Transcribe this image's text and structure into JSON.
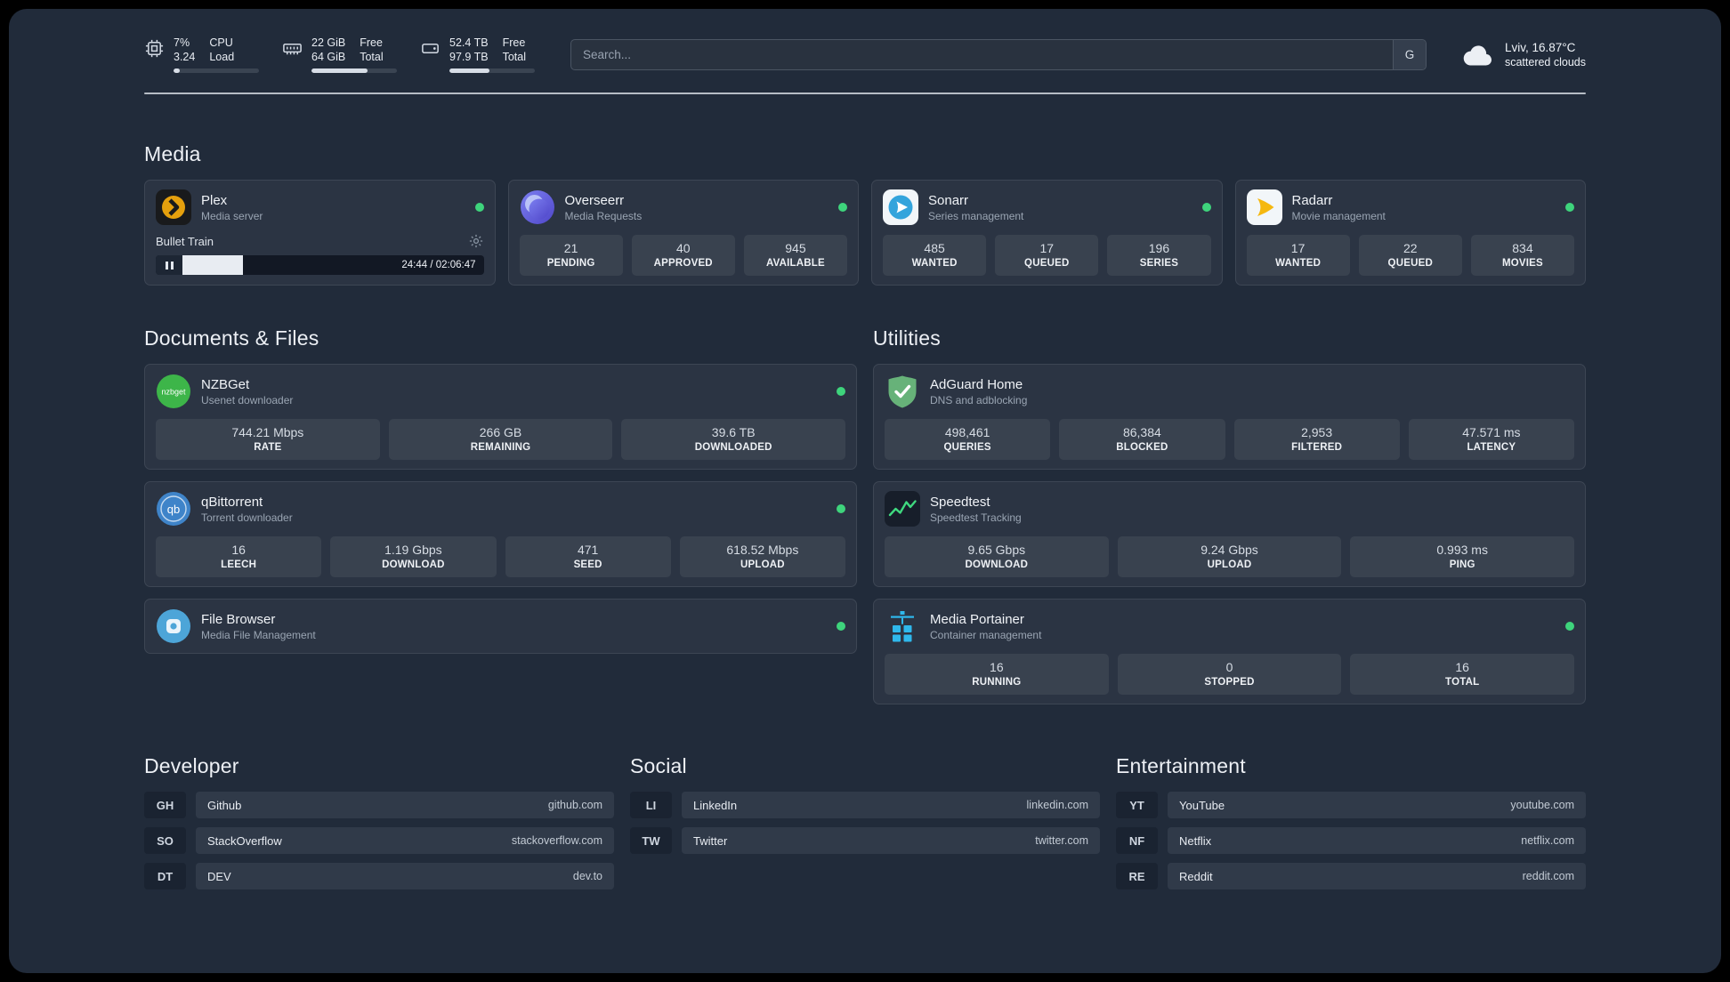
{
  "topbar": {
    "cpu": {
      "line1": "7%",
      "line2": "3.24",
      "label1": "CPU",
      "label2": "Load",
      "progress": 7
    },
    "ram": {
      "line1": "22 GiB",
      "line2": "64 GiB",
      "label1": "Free",
      "label2": "Total",
      "progress": 66
    },
    "disk": {
      "line1": "52.4 TB",
      "line2": "97.9 TB",
      "label1": "Free",
      "label2": "Total",
      "progress": 47
    },
    "search": {
      "placeholder": "Search...",
      "button_label": "G"
    },
    "weather": {
      "location": "Lviv, 16.87°C",
      "condition": "scattered clouds"
    }
  },
  "sections": {
    "media": {
      "title": "Media"
    },
    "documents": {
      "title": "Documents & Files"
    },
    "utilities": {
      "title": "Utilities"
    },
    "developer": {
      "title": "Developer"
    },
    "social": {
      "title": "Social"
    },
    "entertainment": {
      "title": "Entertainment"
    }
  },
  "apps": {
    "plex": {
      "name": "Plex",
      "subtitle": "Media server",
      "player": {
        "track": "Bullet Train",
        "time": "24:44 / 02:06:47",
        "progress": 20
      }
    },
    "overseerr": {
      "name": "Overseerr",
      "subtitle": "Media Requests",
      "stats": [
        {
          "value": "21",
          "label": "PENDING"
        },
        {
          "value": "40",
          "label": "APPROVED"
        },
        {
          "value": "945",
          "label": "AVAILABLE"
        }
      ]
    },
    "sonarr": {
      "name": "Sonarr",
      "subtitle": "Series management",
      "stats": [
        {
          "value": "485",
          "label": "WANTED"
        },
        {
          "value": "17",
          "label": "QUEUED"
        },
        {
          "value": "196",
          "label": "SERIES"
        }
      ]
    },
    "radarr": {
      "name": "Radarr",
      "subtitle": "Movie management",
      "stats": [
        {
          "value": "17",
          "label": "WANTED"
        },
        {
          "value": "22",
          "label": "QUEUED"
        },
        {
          "value": "834",
          "label": "MOVIES"
        }
      ]
    },
    "nzbget": {
      "name": "NZBGet",
      "subtitle": "Usenet downloader",
      "stats": [
        {
          "value": "744.21 Mbps",
          "label": "RATE"
        },
        {
          "value": "266 GB",
          "label": "REMAINING"
        },
        {
          "value": "39.6 TB",
          "label": "DOWNLOADED"
        }
      ]
    },
    "qbittorrent": {
      "name": "qBittorrent",
      "subtitle": "Torrent downloader",
      "stats": [
        {
          "value": "16",
          "label": "LEECH"
        },
        {
          "value": "1.19 Gbps",
          "label": "DOWNLOAD"
        },
        {
          "value": "471",
          "label": "SEED"
        },
        {
          "value": "618.52 Mbps",
          "label": "UPLOAD"
        }
      ]
    },
    "filebrowser": {
      "name": "File Browser",
      "subtitle": "Media File Management"
    },
    "adguard": {
      "name": "AdGuard Home",
      "subtitle": "DNS and adblocking",
      "stats": [
        {
          "value": "498,461",
          "label": "QUERIES"
        },
        {
          "value": "86,384",
          "label": "BLOCKED"
        },
        {
          "value": "2,953",
          "label": "FILTERED"
        },
        {
          "value": "47.571 ms",
          "label": "LATENCY"
        }
      ]
    },
    "speedtest": {
      "name": "Speedtest",
      "subtitle": "Speedtest Tracking",
      "stats": [
        {
          "value": "9.65 Gbps",
          "label": "DOWNLOAD"
        },
        {
          "value": "9.24 Gbps",
          "label": "UPLOAD"
        },
        {
          "value": "0.993 ms",
          "label": "PING"
        }
      ]
    },
    "portainer": {
      "name": "Media Portainer",
      "subtitle": "Container management",
      "stats": [
        {
          "value": "16",
          "label": "RUNNING"
        },
        {
          "value": "0",
          "label": "STOPPED"
        },
        {
          "value": "16",
          "label": "TOTAL"
        }
      ]
    }
  },
  "bookmarks": {
    "developer": [
      {
        "abbr": "GH",
        "name": "Github",
        "url": "github.com"
      },
      {
        "abbr": "SO",
        "name": "StackOverflow",
        "url": "stackoverflow.com"
      },
      {
        "abbr": "DT",
        "name": "DEV",
        "url": "dev.to"
      }
    ],
    "social": [
      {
        "abbr": "LI",
        "name": "LinkedIn",
        "url": "linkedin.com"
      },
      {
        "abbr": "TW",
        "name": "Twitter",
        "url": "twitter.com"
      }
    ],
    "entertainment": [
      {
        "abbr": "YT",
        "name": "YouTube",
        "url": "youtube.com"
      },
      {
        "abbr": "NF",
        "name": "Netflix",
        "url": "netflix.com"
      },
      {
        "abbr": "RE",
        "name": "Reddit",
        "url": "reddit.com"
      }
    ]
  },
  "icon_text": {
    "nzbget": "nzbget",
    "qb": "qb"
  },
  "colors": {
    "status-online": "#3ed47c",
    "accent-bar": "#d7dde6",
    "plex-gold": "#e5a00d",
    "sonarr-blue": "#33a4dc",
    "radarr-gold": "#f5b810",
    "nzbget-green": "#3db549",
    "adguard-green": "#67b279",
    "portainer-blue": "#2fb8ec",
    "speedtest-line": "#3fd97f"
  }
}
